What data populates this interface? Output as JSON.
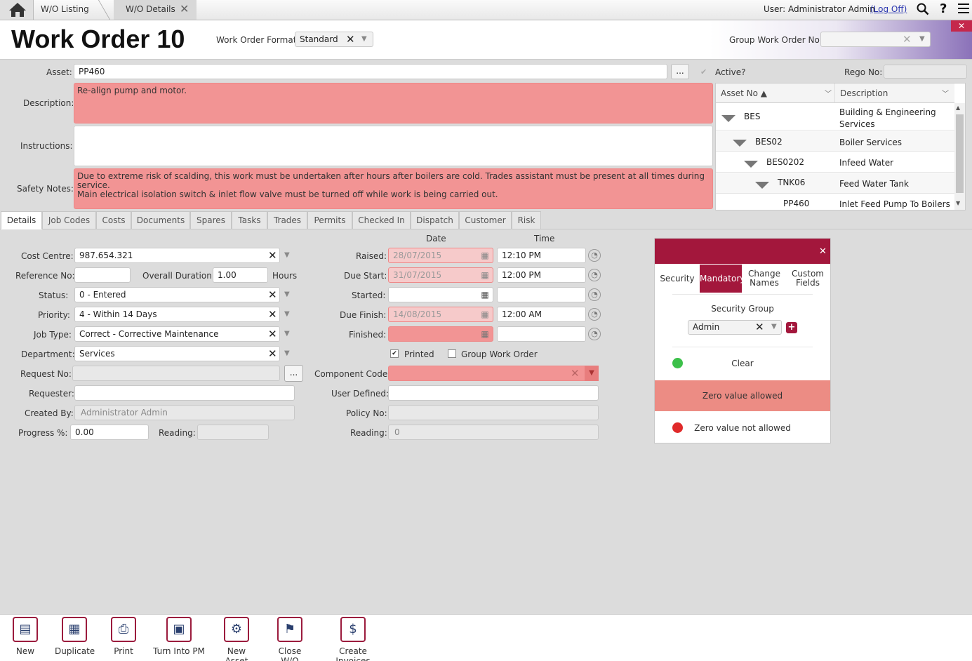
{
  "nav": {
    "crumb1": "W/O Listing",
    "crumb2": "W/O Details",
    "user_label": "User: Administrator Admin",
    "logoff": "(Log Off)",
    "help": "?"
  },
  "header": {
    "title": "Work Order",
    "number": "10",
    "format_label": "Work Order Format",
    "format_value": "Standard",
    "group_wo_label": "Group Work Order No:"
  },
  "asset": {
    "label": "Asset:",
    "value": "PP460",
    "browse": "...",
    "active_label": "Active?",
    "rego_label": "Rego No:"
  },
  "description": {
    "label": "Description:",
    "value": "Re-align pump and motor."
  },
  "instructions": {
    "label": "Instructions:",
    "value": ""
  },
  "safety": {
    "label": "Safety Notes:",
    "line1": "Due to extreme risk of scalding, this work must be undertaken after hours after boilers are cold.  Trades assistant must be present at all times during service.",
    "line2": "Main electrical isolation switch & inlet flow valve must be turned off while work is being carried out."
  },
  "tree": {
    "col1": "Asset No ▲",
    "col2": "Description",
    "rows": [
      {
        "asset": "BES",
        "desc1": "Building & Engineering",
        "desc2": "Services"
      },
      {
        "asset": "BES02",
        "desc1": "Boiler Services",
        "desc2": ""
      },
      {
        "asset": "BES0202",
        "desc1": "Infeed Water",
        "desc2": ""
      },
      {
        "asset": "TNK06",
        "desc1": "Feed Water Tank",
        "desc2": ""
      },
      {
        "asset": "PP460",
        "desc1": "Inlet Feed Pump To Boilers",
        "desc2": ""
      }
    ]
  },
  "tabs": [
    "Details",
    "Job Codes",
    "Costs",
    "Documents",
    "Spares",
    "Tasks",
    "Trades",
    "Permits",
    "Checked In",
    "Dispatch",
    "Customer",
    "Risk"
  ],
  "left": {
    "cost_centre_label": "Cost Centre:",
    "cost_centre": "987.654.321",
    "ref_label": "Reference No:",
    "ref": "",
    "duration_label": "Overall Duration:",
    "duration": "1.00",
    "hours": "Hours",
    "status_label": "Status:",
    "status": "0 - Entered",
    "priority_label": "Priority:",
    "priority": "4 - Within 14 Days",
    "jobtype_label": "Job Type:",
    "jobtype": "Correct - Corrective Maintenance",
    "dept_label": "Department:",
    "dept": "Services",
    "request_label": "Request No:",
    "request": "",
    "request_browse": "...",
    "requester_label": "Requester:",
    "requester": "",
    "createdby_label": "Created By:",
    "createdby": "Administrator Admin",
    "progress_label": "Progress %:",
    "progress": "0.00",
    "reading_label": "Reading:",
    "reading": ""
  },
  "mid": {
    "date_hdr": "Date",
    "time_hdr": "Time",
    "raised_label": "Raised:",
    "raised_date": "28/07/2015",
    "raised_time": "12:10 PM",
    "duestart_label": "Due Start:",
    "duestart_date": "31/07/2015",
    "duestart_time": "12:00 PM",
    "started_label": "Started:",
    "started_date": "",
    "started_time": "",
    "duefinish_label": "Due Finish:",
    "duefinish_date": "14/08/2015",
    "duefinish_time": "12:00 AM",
    "finished_label": "Finished:",
    "finished_date": "",
    "finished_time": "",
    "printed_label": "Printed",
    "group_wo_label": "Group Work Order",
    "component_label": "Component Code:",
    "component": "",
    "userdef_label": "User Defined:",
    "userdef": "",
    "policy_label": "Policy No:",
    "policy": "",
    "reading_label": "Reading:",
    "reading": "0"
  },
  "panel": {
    "tabs": [
      "Security",
      "Mandatory",
      "Change Names",
      "Custom Fields"
    ],
    "group_label": "Security Group",
    "group_value": "Admin",
    "clear": "Clear",
    "zero_allowed": "Zero value allowed",
    "zero_not_allowed": "Zero value not allowed",
    "accent": "#a3173c"
  },
  "toolbar": [
    "New",
    "Duplicate",
    "Print",
    "Turn Into PM",
    "New Asset",
    "Close W/O",
    "Create Invoices"
  ]
}
